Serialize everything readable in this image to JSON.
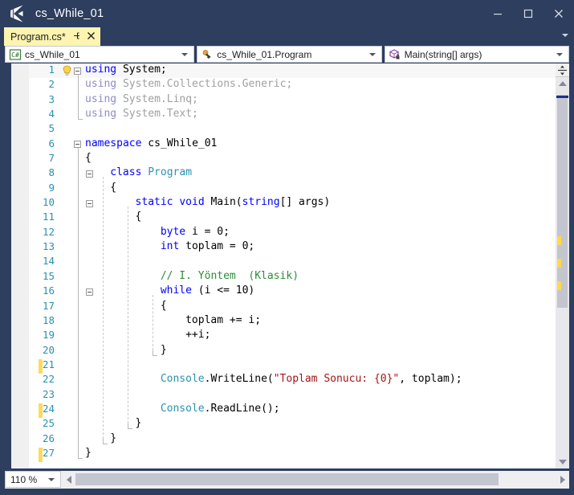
{
  "window": {
    "title": "cs_While_01",
    "app_icon": "visual-studio-icon",
    "minimize_label": "—",
    "maximize_label": "❐",
    "close_label": "✕"
  },
  "tabs": {
    "active": {
      "label": "Program.cs*",
      "pin_icon": "pin-icon",
      "close_icon": "close-icon"
    },
    "overflow_icon": "chevron-down-icon"
  },
  "navbar": {
    "project": {
      "icon": "csharp-project-icon",
      "value": "cs_While_01"
    },
    "type": {
      "icon": "class-icon",
      "value": "cs_While_01.Program"
    },
    "member": {
      "icon": "method-private-icon",
      "value": "Main(string[] args)"
    },
    "caret_icon": "chevron-down-icon"
  },
  "editor": {
    "lightbulb_icon": "lightbulb-icon",
    "lines": [
      {
        "n": "1",
        "indent": 0,
        "highlight": true,
        "tokens": [
          {
            "t": "using ",
            "c": "kw"
          },
          {
            "t": "System;",
            "c": "plain"
          }
        ]
      },
      {
        "n": "2",
        "indent": 0,
        "tokens": [
          {
            "t": "using ",
            "c": "kwg"
          },
          {
            "t": "System.Collections.Generic;",
            "c": "gray"
          }
        ]
      },
      {
        "n": "3",
        "indent": 0,
        "tokens": [
          {
            "t": "using ",
            "c": "kwg"
          },
          {
            "t": "System.Linq;",
            "c": "gray"
          }
        ]
      },
      {
        "n": "4",
        "indent": 0,
        "tokens": [
          {
            "t": "using ",
            "c": "kwg"
          },
          {
            "t": "System.Text;",
            "c": "gray"
          }
        ]
      },
      {
        "n": "5",
        "indent": 0,
        "tokens": []
      },
      {
        "n": "6",
        "indent": 0,
        "tokens": [
          {
            "t": "namespace ",
            "c": "kw"
          },
          {
            "t": "cs_While_01",
            "c": "plain"
          }
        ]
      },
      {
        "n": "7",
        "indent": 0,
        "tokens": [
          {
            "t": "{",
            "c": "plain"
          }
        ]
      },
      {
        "n": "8",
        "indent": 1,
        "tokens": [
          {
            "t": "class ",
            "c": "kw"
          },
          {
            "t": "Program",
            "c": "typ"
          }
        ]
      },
      {
        "n": "9",
        "indent": 1,
        "tokens": [
          {
            "t": "{",
            "c": "plain"
          }
        ]
      },
      {
        "n": "10",
        "indent": 2,
        "tokens": [
          {
            "t": "static void ",
            "c": "kw"
          },
          {
            "t": "Main(",
            "c": "plain"
          },
          {
            "t": "string",
            "c": "kw"
          },
          {
            "t": "[] args)",
            "c": "plain"
          }
        ]
      },
      {
        "n": "11",
        "indent": 2,
        "tokens": [
          {
            "t": "{",
            "c": "plain"
          }
        ]
      },
      {
        "n": "12",
        "indent": 3,
        "tokens": [
          {
            "t": "byte ",
            "c": "kw"
          },
          {
            "t": "i = 0;",
            "c": "plain"
          }
        ]
      },
      {
        "n": "13",
        "indent": 3,
        "tokens": [
          {
            "t": "int ",
            "c": "kw"
          },
          {
            "t": "toplam = 0;",
            "c": "plain"
          }
        ]
      },
      {
        "n": "14",
        "indent": 3,
        "tokens": []
      },
      {
        "n": "15",
        "indent": 3,
        "tokens": [
          {
            "t": "// I. Yöntem  (Klasik)",
            "c": "cmt"
          }
        ]
      },
      {
        "n": "16",
        "indent": 3,
        "tokens": [
          {
            "t": "while ",
            "c": "kw"
          },
          {
            "t": "(i <= 10)",
            "c": "plain"
          }
        ]
      },
      {
        "n": "17",
        "indent": 3,
        "tokens": [
          {
            "t": "{",
            "c": "plain"
          }
        ]
      },
      {
        "n": "18",
        "indent": 4,
        "tokens": [
          {
            "t": "toplam += i;",
            "c": "plain"
          }
        ]
      },
      {
        "n": "19",
        "indent": 4,
        "tokens": [
          {
            "t": "++i;",
            "c": "plain"
          }
        ]
      },
      {
        "n": "20",
        "indent": 3,
        "tokens": [
          {
            "t": "}",
            "c": "plain"
          }
        ]
      },
      {
        "n": "21",
        "indent": 3,
        "tokens": []
      },
      {
        "n": "22",
        "indent": 3,
        "tokens": [
          {
            "t": "Console",
            "c": "typ"
          },
          {
            "t": ".WriteLine(",
            "c": "plain"
          },
          {
            "t": "\"Toplam Sonucu: {0}\"",
            "c": "str"
          },
          {
            "t": ", toplam);",
            "c": "plain"
          }
        ]
      },
      {
        "n": "23",
        "indent": 3,
        "tokens": []
      },
      {
        "n": "24",
        "indent": 3,
        "tokens": [
          {
            "t": "Console",
            "c": "typ"
          },
          {
            "t": ".ReadLine();",
            "c": "plain"
          }
        ]
      },
      {
        "n": "25",
        "indent": 2,
        "tokens": [
          {
            "t": "}",
            "c": "plain"
          }
        ]
      },
      {
        "n": "26",
        "indent": 1,
        "tokens": [
          {
            "t": "}",
            "c": "plain"
          }
        ]
      },
      {
        "n": "27",
        "indent": 0,
        "tokens": [
          {
            "t": "}",
            "c": "plain"
          }
        ]
      }
    ],
    "changed_lines": [
      21,
      24,
      27
    ],
    "fold_lines": [
      1,
      6,
      8,
      10,
      16
    ]
  },
  "vscrollbar": {
    "split_icon": "split-view-icon",
    "up_icon": "triangle-up-icon",
    "down_icon": "triangle-down-icon",
    "caret_marker": "caret-position-marker",
    "change_markers": 3
  },
  "statusbar": {
    "zoom": "110 %",
    "zoom_caret_icon": "chevron-down-icon",
    "hscroll_left_icon": "triangle-left-icon",
    "hscroll_right_icon": "triangle-right-icon"
  },
  "colors": {
    "chrome": "#2d3e5e",
    "tab_active": "#fdf4b0",
    "keyword": "#0000ff",
    "type": "#2b91af",
    "comment": "#2e8b3a",
    "string": "#a31515",
    "linenumber": "#2b91af",
    "change_bar": "#ffd95c"
  }
}
